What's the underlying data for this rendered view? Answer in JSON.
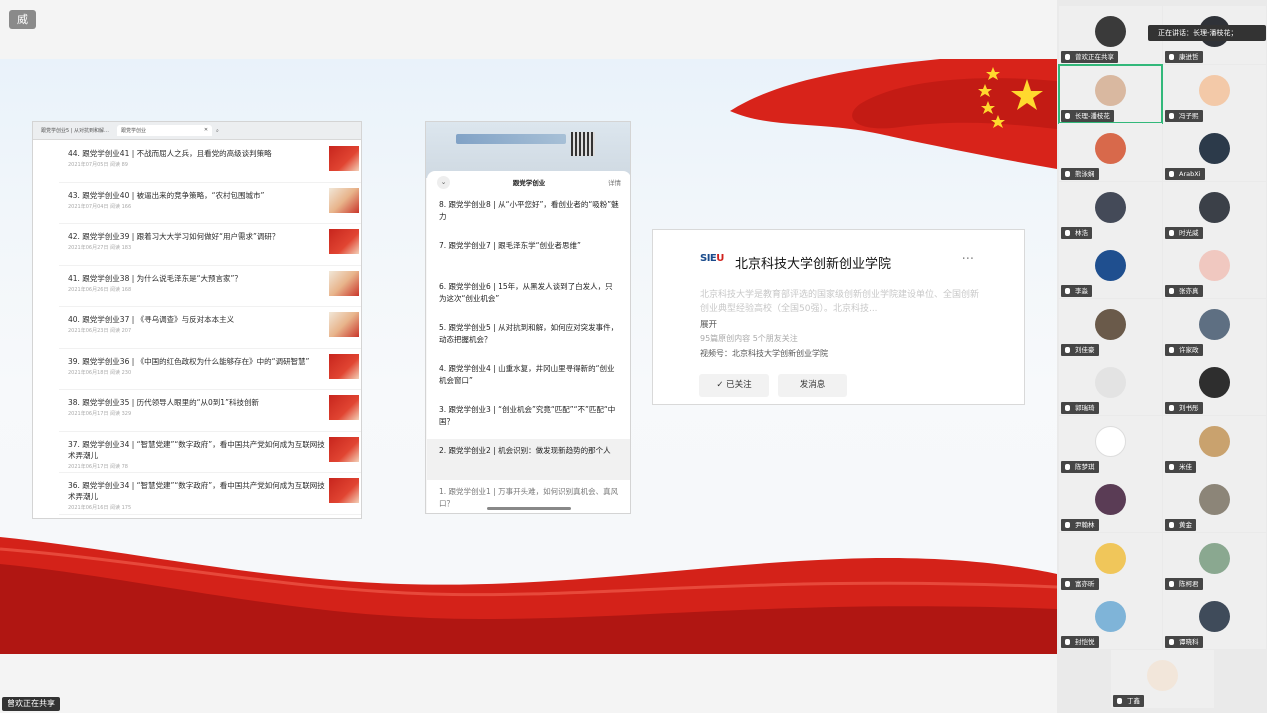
{
  "app_badge": "威",
  "share_footer": "曾欢正在共享",
  "speaking_tip": "正在讲话：长理-潘枝花；",
  "browser": {
    "tabs": [
      "跟党学创业5 | 从对抗到和解…",
      "跟党学创业"
    ],
    "articles": [
      {
        "title": "44. 跟党学创业41 | 不战而屈人之兵，且看党的高级谈判策略",
        "date": "2021年07月05日  阅读 89"
      },
      {
        "title": "43. 跟党学创业40 | 被逼出来的竞争策略，“农村包围城市”",
        "date": "2021年07月04日  阅读 166"
      },
      {
        "title": "42. 跟党学创业39 | 跟着习大大学习如何做好“用户需求”调研？",
        "date": "2021年06月27日  阅读 183"
      },
      {
        "title": "41. 跟党学创业38 | 为什么说毛泽东是“大预言家”？",
        "date": "2021年06月26日  阅读 168"
      },
      {
        "title": "40. 跟党学创业37 | 《寻乌调查》与反对本本主义",
        "date": "2021年06月23日  阅读 207"
      },
      {
        "title": "39. 跟党学创业36 | 《中国的红色政权为什么能够存在》中的“调研智慧”",
        "date": "2021年06月18日  阅读 230"
      },
      {
        "title": "38. 跟党学创业35 | 历代领导人眼里的“从0到1”科技创新",
        "date": "2021年06月17日  阅读 329"
      },
      {
        "title": "37. 跟党学创业34 | “智慧党建”“数字政府”，看中国共产党如何成为互联网技术弄潮儿",
        "date": "2021年06月17日  阅读 78"
      },
      {
        "title": "36. 跟党学创业34 | “智慧党建”“数字政府”，看中国共产党如何成为互联网技术弄潮儿",
        "date": "2021年06月16日  阅读 175"
      }
    ]
  },
  "phone": {
    "sheet_title": "跟党学创业",
    "detail": "详情",
    "items": [
      "8. 跟党学创业8 | 从“小平您好”，看创业者的“吸粉”魅力",
      "7. 跟党学创业7 | 跟毛泽东学“创业者思维”",
      "6. 跟党学创业6 | 15年，从黑发人谈到了白发人，只为这次“创业机会”",
      "5. 跟党学创业5 | 从对抗到和解，如何应对突发事件，动态把握机会？",
      "4. 跟党学创业4 | 山重水复，井冈山里寻得新的“创业机会窗口”",
      "3. 跟党学创业3 | “创业机会”究竟“匹配”“不”匹配“中国？",
      "2. 跟党学创业2 | 机会识别：做发现新趋势的那个人",
      "1. 跟党学创业1 | 万事开头难，如何识别真机会、真风口？"
    ]
  },
  "profile": {
    "logo_main": "SIE",
    "logo_accent": "U",
    "name": "北京科技大学创新创业学院",
    "more": "···",
    "description": "北京科技大学是教育部评选的国家级创新创业学院建设单位、全国创新创业典型经验高校（全国50强）。北京科技...",
    "expand": "展开",
    "stats": "95篇原创内容  5个朋友关注",
    "video": "视频号：北京科技大学创新创业学院",
    "follow_btn": "✓ 已关注",
    "message_btn": "发消息"
  },
  "participants": [
    {
      "name": "曾欢正在共享",
      "color": "#3a3a3a"
    },
    {
      "name": "康进哲",
      "color": "#2f3238"
    },
    {
      "name": "长理-潘枝花",
      "color": "#d9b8a0"
    },
    {
      "name": "冯子熙",
      "color": "#f3c9a8"
    },
    {
      "name": "熊泳娴",
      "color": "#d8694b"
    },
    {
      "name": "ArabXi",
      "color": "#2c3a4a"
    },
    {
      "name": "林浩",
      "color": "#444a58"
    },
    {
      "name": "时光威",
      "color": "#3b4048"
    },
    {
      "name": "李淼",
      "color": "#1f4f8f"
    },
    {
      "name": "张亦真",
      "color": "#f0c8c0"
    },
    {
      "name": "刘佳豪",
      "color": "#6a5a4a"
    },
    {
      "name": "许家政",
      "color": "#5e6f82"
    },
    {
      "name": "郭瑞琦",
      "color": "#e3e3e3"
    },
    {
      "name": "刘书彤",
      "color": "#2e2e2e"
    },
    {
      "name": "陈梦琪",
      "color": "#ffffff"
    },
    {
      "name": "米佳",
      "color": "#c9a26e"
    },
    {
      "name": "尹翰林",
      "color": "#5a3c55"
    },
    {
      "name": "黄金",
      "color": "#8c8578"
    },
    {
      "name": "富亦昕",
      "color": "#f0c65a"
    },
    {
      "name": "陈柯君",
      "color": "#8aa890"
    },
    {
      "name": "封恺悦",
      "color": "#7fb4d8"
    },
    {
      "name": "谭晓科",
      "color": "#3f4b5a"
    },
    {
      "name": "丁鑫",
      "color": "#f2e6da"
    }
  ]
}
